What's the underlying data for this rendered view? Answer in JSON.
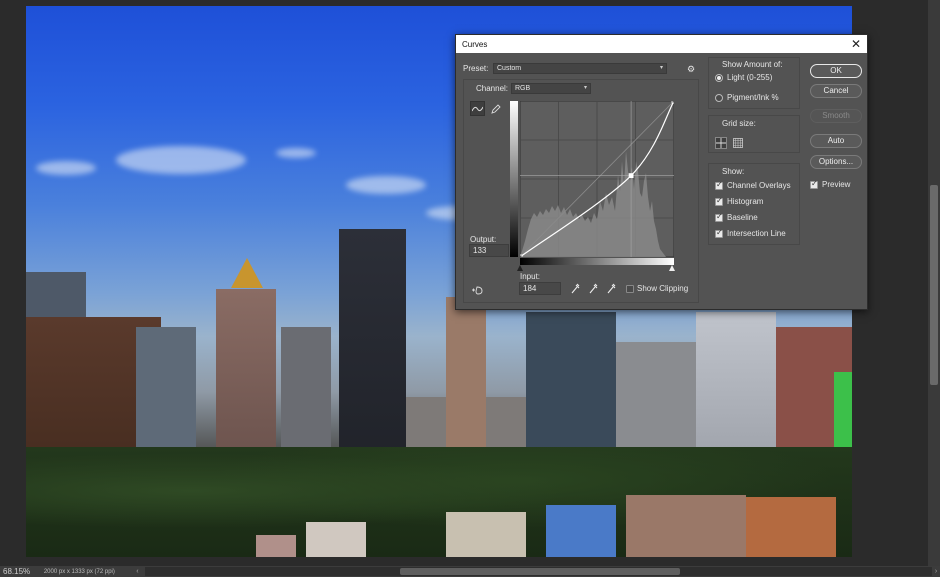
{
  "status": {
    "zoom": "68.15%",
    "doc_info": "2000 px x 1333 px (72 ppi)",
    "arrow_left": "‹",
    "arrow_right": "›"
  },
  "dialog": {
    "title": "Curves",
    "close_glyph": "✕",
    "preset_label": "Preset:",
    "preset_value": "Custom",
    "gear_glyph": "⚙",
    "channel_label": "Channel:",
    "channel_value": "RGB",
    "output_label": "Output:",
    "output_value": "133",
    "input_label": "Input:",
    "input_value": "184",
    "show_clipping_label": "Show Clipping",
    "show_amount_title": "Show Amount of:",
    "light_option": "Light  (0-255)",
    "pigment_option": "Pigment/Ink %",
    "grid_size_title": "Grid size:",
    "show_title": "Show:",
    "channel_overlays": "Channel Overlays",
    "histogram": "Histogram",
    "baseline": "Baseline",
    "intersection_line": "Intersection Line",
    "buttons": {
      "ok": "OK",
      "cancel": "Cancel",
      "smooth": "Smooth",
      "auto": "Auto",
      "options": "Options..."
    },
    "preview_label": "Preview",
    "curve_points": [
      [
        0,
        0
      ],
      [
        184,
        133
      ],
      [
        255,
        255
      ]
    ]
  },
  "icons": {
    "curve_tool": "curve-point-icon",
    "pencil_tool": "pencil-icon",
    "on_image": "hand-adjust-icon",
    "eyedroppers": [
      "black-eyedropper-icon",
      "gray-eyedropper-icon",
      "white-eyedropper-icon"
    ]
  },
  "colors": {
    "dialog_bg": "#535353",
    "titlebar_bg": "#ffffff",
    "curve": "#ffffff",
    "graph_bg": "#5e5e5e"
  }
}
